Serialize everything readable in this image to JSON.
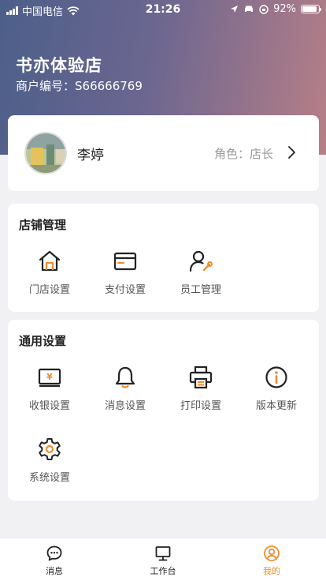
{
  "status_bar": {
    "carrier": "中国电信",
    "time": "21:26",
    "battery": "92%",
    "battery_level": 0.92
  },
  "store": {
    "name": "书亦体验店",
    "merchant_no": "商户编号：S66666769"
  },
  "profile": {
    "name": "李婷",
    "role": "角色：店长"
  },
  "shop_section": {
    "title": "店铺管理",
    "items": [
      {
        "label": "门店设置",
        "icon": "store-icon"
      },
      {
        "label": "支付设置",
        "icon": "card-icon"
      },
      {
        "label": "员工管理",
        "icon": "staff-icon"
      }
    ]
  },
  "general_section": {
    "title": "通用设置",
    "items": [
      {
        "label": "收银设置",
        "icon": "cashier-icon"
      },
      {
        "label": "消息设置",
        "icon": "bell-icon"
      },
      {
        "label": "打印设置",
        "icon": "printer-icon"
      },
      {
        "label": "版本更新",
        "icon": "info-icon"
      },
      {
        "label": "系统设置",
        "icon": "gear-icon"
      }
    ]
  },
  "tabbar": {
    "items": [
      {
        "label": "消息",
        "icon": "message-icon"
      },
      {
        "label": "工作台",
        "icon": "monitor-icon"
      },
      {
        "label": "我的",
        "icon": "user-icon"
      }
    ],
    "active": "我的"
  },
  "colors": {
    "accent": "#f08c2d",
    "icon_dark": "#222222"
  }
}
